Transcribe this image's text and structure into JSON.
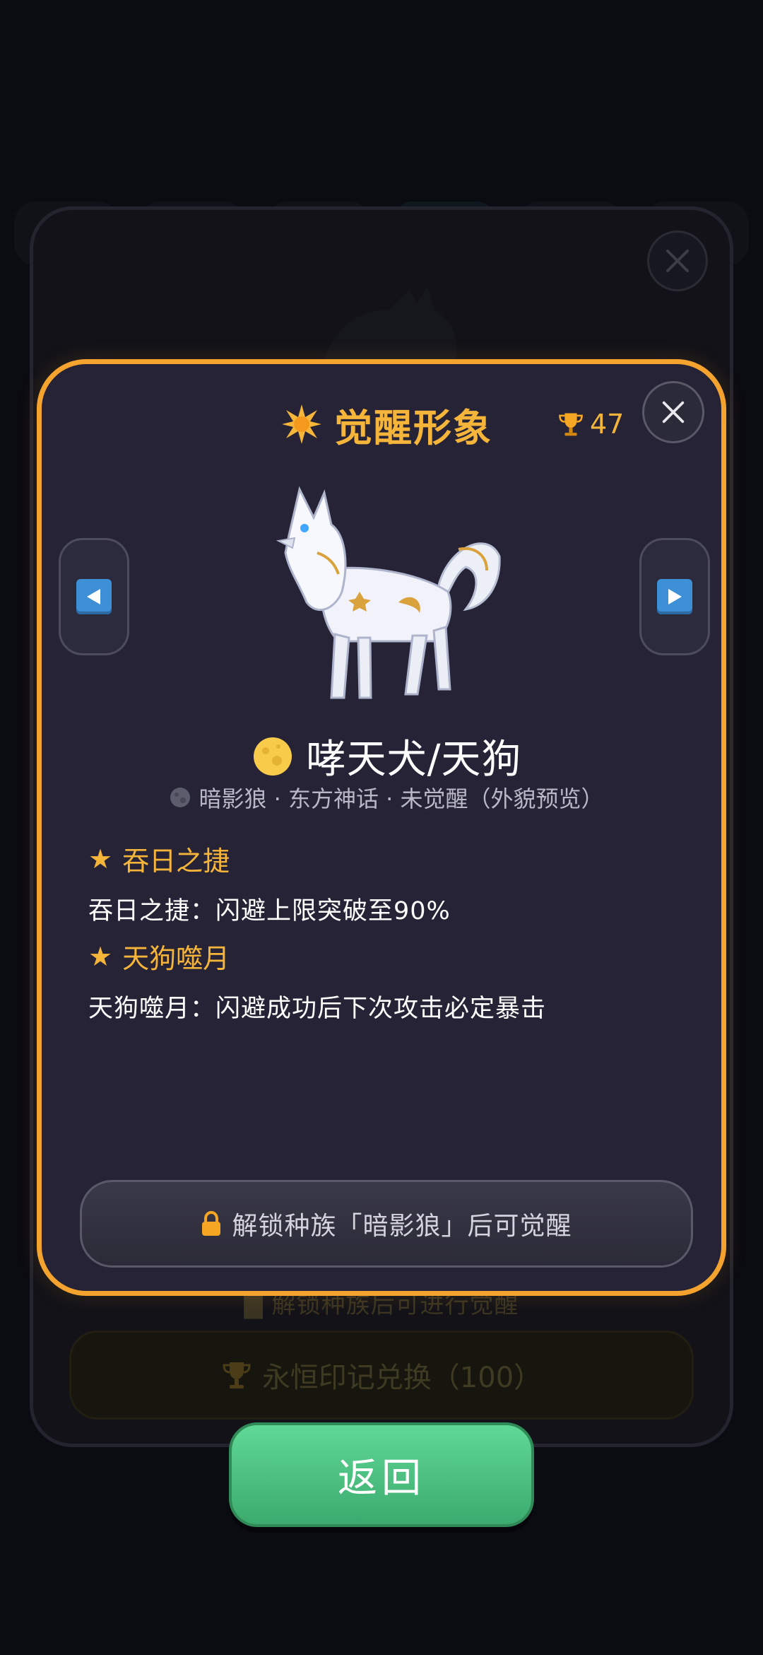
{
  "modal": {
    "title": "觉醒形象",
    "trophy_count": "47",
    "character_name": "哮天犬/天狗",
    "subtitle": "暗影狼 · 东方神话 · 未觉醒（外貌预览）",
    "skills": [
      {
        "title": "吞日之捷",
        "description": "吞日之捷：闪避上限突破至90%"
      },
      {
        "title": "天狗噬月",
        "description": "天狗噬月：闪避成功后下次攻击必定暴击"
      }
    ],
    "unlock_label": "解锁种族「暗影狼」后可觉醒"
  },
  "background": {
    "lock_text": "解锁种族后可进行觉醒",
    "redeem_label": "永恒印记兑换（100）"
  },
  "back_label": "返回",
  "colors": {
    "accent": "#f4a32e",
    "modal_bg": "#252335",
    "back_button": "#4cc282"
  }
}
